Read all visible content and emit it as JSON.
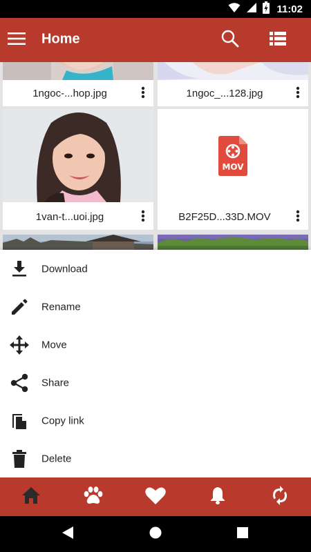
{
  "status_bar": {
    "time": "11:02"
  },
  "app_bar": {
    "title": "Home"
  },
  "files": [
    {
      "name": "1ngoc-...hop.jpg"
    },
    {
      "name": "1ngoc_...128.jpg"
    },
    {
      "name": "1van-t...uoi.jpg"
    },
    {
      "name": "B2F25D...33D.MOV",
      "badge": "MOV"
    }
  ],
  "sheet": {
    "items": [
      {
        "label": "Download",
        "icon": "download-icon"
      },
      {
        "label": "Rename",
        "icon": "pencil-icon"
      },
      {
        "label": "Move",
        "icon": "move-icon"
      },
      {
        "label": "Share",
        "icon": "share-icon"
      },
      {
        "label": "Copy link",
        "icon": "copy-icon"
      },
      {
        "label": "Delete",
        "icon": "trash-icon"
      }
    ]
  },
  "bottom_nav": [
    "home-icon",
    "paw-icon",
    "heart-icon",
    "bell-icon",
    "sync-icon"
  ],
  "colors": {
    "primary": "#b73a2c",
    "nav_active": "#222222",
    "nav_inactive": "#ffffff"
  }
}
